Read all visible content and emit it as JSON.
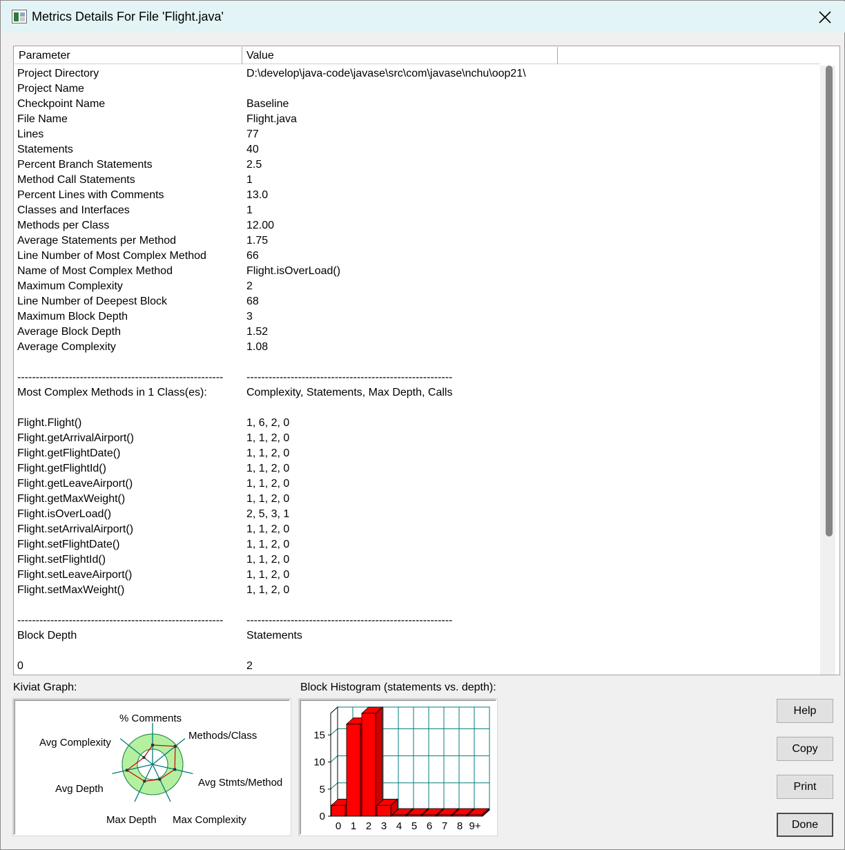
{
  "window": {
    "title": "Metrics Details For File 'Flight.java'"
  },
  "table": {
    "columns": [
      "Parameter",
      "Value"
    ],
    "rows": [
      [
        "Project Directory",
        "D:\\develop\\java-code\\javase\\src\\com\\javase\\nchu\\oop21\\"
      ],
      [
        "Project Name",
        ""
      ],
      [
        "Checkpoint Name",
        "Baseline"
      ],
      [
        "File Name",
        "Flight.java"
      ],
      [
        "Lines",
        "77"
      ],
      [
        "Statements",
        "40"
      ],
      [
        "Percent Branch Statements",
        "2.5"
      ],
      [
        "Method Call Statements",
        "1"
      ],
      [
        "Percent Lines with Comments",
        "13.0"
      ],
      [
        "Classes and Interfaces",
        "1"
      ],
      [
        "Methods per Class",
        "12.00"
      ],
      [
        "Average Statements per Method",
        "1.75"
      ],
      [
        "Line Number of Most Complex Method",
        "66"
      ],
      [
        "Name of Most Complex Method",
        "Flight.isOverLoad()"
      ],
      [
        "Maximum Complexity",
        "2"
      ],
      [
        "Line Number of Deepest Block",
        "68"
      ],
      [
        "Maximum Block Depth",
        "3"
      ],
      [
        "Average Block Depth",
        "1.52"
      ],
      [
        "Average Complexity",
        "1.08"
      ],
      [
        "",
        ""
      ],
      [
        "--------------------------------------------------------",
        "--------------------------------------------------------"
      ],
      [
        "Most Complex Methods in 1 Class(es):",
        "Complexity, Statements, Max Depth, Calls"
      ],
      [
        "",
        ""
      ],
      [
        "Flight.Flight()",
        "1, 6, 2, 0"
      ],
      [
        "Flight.getArrivalAirport()",
        "1, 1, 2, 0"
      ],
      [
        "Flight.getFlightDate()",
        "1, 1, 2, 0"
      ],
      [
        "Flight.getFlightId()",
        "1, 1, 2, 0"
      ],
      [
        "Flight.getLeaveAirport()",
        "1, 1, 2, 0"
      ],
      [
        "Flight.getMaxWeight()",
        "1, 1, 2, 0"
      ],
      [
        "Flight.isOverLoad()",
        "2, 5, 3, 1"
      ],
      [
        "Flight.setArrivalAirport()",
        "1, 1, 2, 0"
      ],
      [
        "Flight.setFlightDate()",
        "1, 1, 2, 0"
      ],
      [
        "Flight.setFlightId()",
        "1, 1, 2, 0"
      ],
      [
        "Flight.setLeaveAirport()",
        "1, 1, 2, 0"
      ],
      [
        "Flight.setMaxWeight()",
        "1, 1, 2, 0"
      ],
      [
        "",
        ""
      ],
      [
        "--------------------------------------------------------",
        "--------------------------------------------------------"
      ],
      [
        "Block Depth",
        "Statements"
      ],
      [
        "",
        ""
      ],
      [
        "0",
        "2"
      ]
    ]
  },
  "kiviat": {
    "label": "Kiviat Graph:",
    "axes": [
      "% Comments",
      "Methods/Class",
      "Avg Stmts/Method",
      "Max Complexity",
      "Max Depth",
      "Avg Depth",
      "Avg Complexity"
    ],
    "colors": {
      "ring": "#b4f0a0",
      "axis": "#007b7b",
      "polygon": "#cc0000"
    }
  },
  "histogram": {
    "label": "Block Histogram (statements vs. depth):",
    "colors": {
      "bar": "#ff0000",
      "grid": "#007b7b"
    }
  },
  "chart_data": {
    "type": "bar",
    "categories": [
      "0",
      "1",
      "2",
      "3",
      "4",
      "5",
      "6",
      "7",
      "8",
      "9+"
    ],
    "values": [
      2,
      17,
      19,
      2,
      0,
      0,
      0,
      0,
      0,
      0
    ],
    "yticks": [
      0,
      5,
      10,
      15
    ],
    "ylim": [
      0,
      19
    ]
  },
  "buttons": {
    "help": "Help",
    "copy": "Copy",
    "print": "Print",
    "done": "Done"
  }
}
